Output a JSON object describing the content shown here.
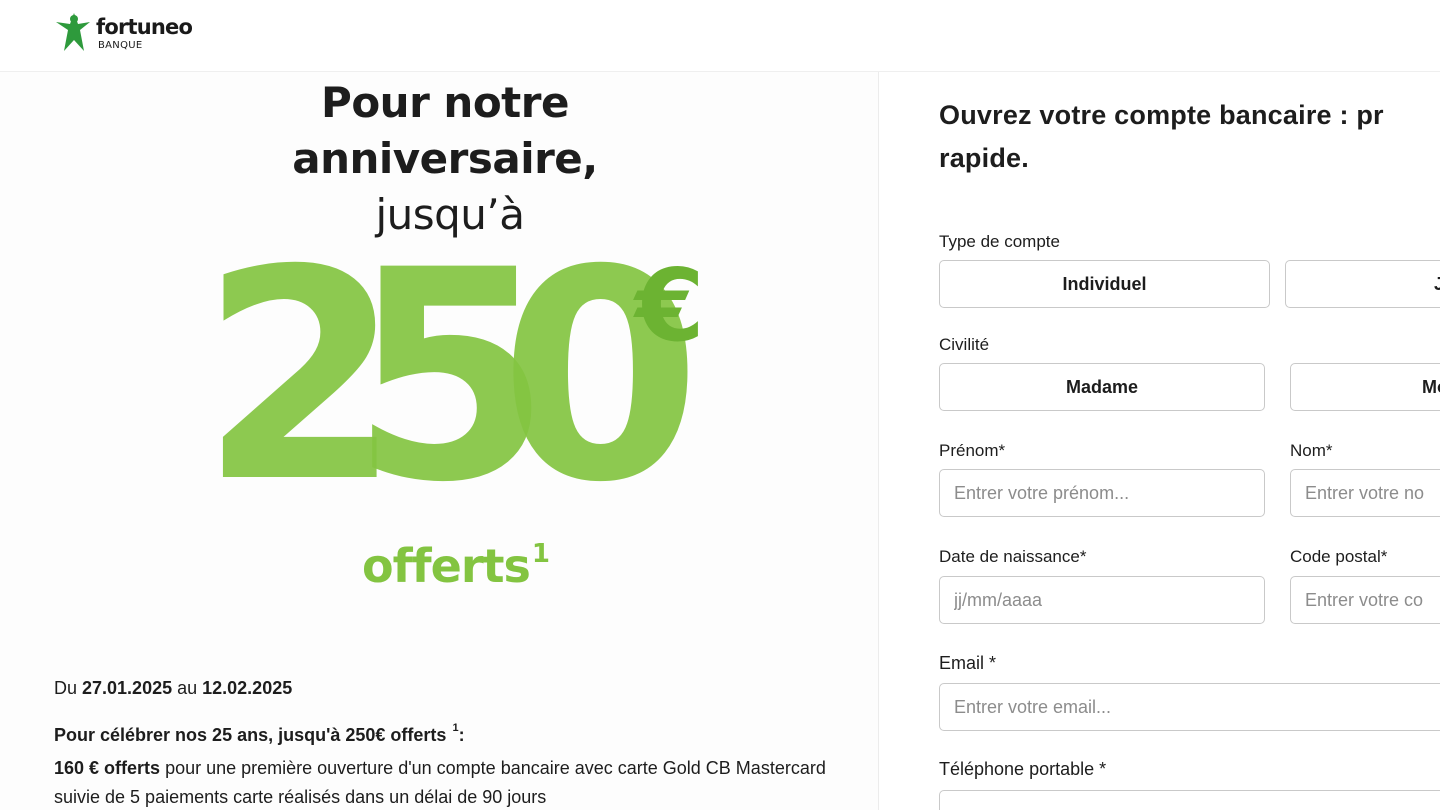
{
  "brand": {
    "name": "fortuneo",
    "subtitle": "BANQUE",
    "accent": "#2e9a3c",
    "promo_green": "#83c441"
  },
  "promo": {
    "title_line1": "Pour notre",
    "title_line2": "anniversaire,",
    "upto": "jusqu’à",
    "amount": "250",
    "currency": "€",
    "offered": "offerts",
    "offered_sup": "1",
    "date_prefix": "Du ",
    "date_start": "27.01.2025",
    "date_mid": " au ",
    "date_end": "12.02.2025",
    "celebrate": "Pour célébrer nos 25 ans, jusqu'à 250€ offerts",
    "celebrate_sup": "1",
    "celebrate_suffix": ":",
    "offer_amount": "160 € offerts",
    "offer_text": " pour une première ouverture d'un compte bancaire avec carte Gold CB Mastercard suivie de 5 paiements carte réalisés dans un délai de 90 jours"
  },
  "form": {
    "title": "Ouvrez votre compte bancaire : pr rapide.",
    "title_line1": "Ouvrez votre compte bancaire : pr",
    "title_line2": "rapide.",
    "account_type_label": "Type de compte",
    "account_type_options": [
      "Individuel",
      "Jo"
    ],
    "civility_label": "Civilité",
    "civility_options": [
      "Madame",
      "Mon"
    ],
    "firstname_label": "Prénom*",
    "firstname_placeholder": "Entrer votre prénom...",
    "lastname_label": "Nom*",
    "lastname_placeholder": "Entrer votre no",
    "birthdate_label": "Date de naissance*",
    "birthdate_placeholder": "jj/mm/aaaa",
    "postcode_label": "Code postal*",
    "postcode_placeholder": "Entrer votre co",
    "email_label": "Email *",
    "email_placeholder": "Entrer votre email...",
    "phone_label": "Téléphone portable *"
  }
}
